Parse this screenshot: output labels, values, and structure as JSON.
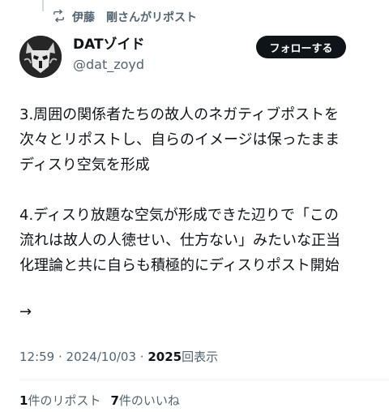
{
  "repost_context": {
    "text": "伊藤　剛さんがリポスト"
  },
  "author": {
    "display_name": "DATゾイド",
    "handle": "@dat_zoyd"
  },
  "follow_button": {
    "label": "フォローする"
  },
  "tweet": {
    "paragraph1": [
      "3.周囲の関係者たちの故人のネガティブポストを",
      "次々とリポストし、自らのイメージは保ったまま",
      "ディスり空気を形成"
    ],
    "paragraph2": [
      "4.ディスり放題な空気が形成できた辺りで「この",
      "流れは故人の人徳せい、仕方ない」みたいな正当",
      "化理論と共に自らも積極的にディスりポスト開始"
    ],
    "arrow": "→"
  },
  "meta": {
    "time": "12:59",
    "separator": " · ",
    "date": "2024/10/03",
    "view_count": "2025",
    "view_label": "回表示"
  },
  "stats": {
    "reposts_count": "1",
    "reposts_label": "件のリポスト",
    "likes_count": "7",
    "likes_label": "件のいいね"
  },
  "icons": {
    "repost": "repost-icon",
    "avatar": "avatar-image"
  }
}
